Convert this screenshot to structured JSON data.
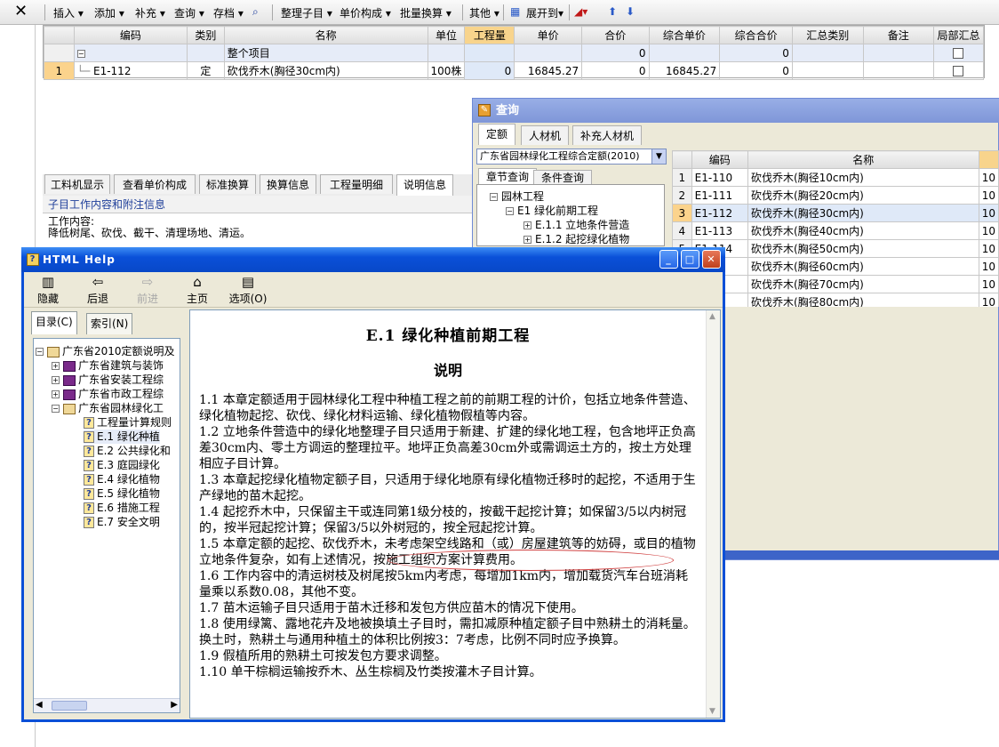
{
  "toolbar": {
    "close": "✕",
    "items": [
      "插入",
      "添加",
      "补充",
      "查询",
      "存档",
      "整理子目",
      "单价构成",
      "批量换算",
      "其他",
      "展开到"
    ]
  },
  "grid": {
    "headers": [
      "编码",
      "类别",
      "名称",
      "单位",
      "工程量",
      "单价",
      "合价",
      "综合单价",
      "综合合价",
      "汇总类别",
      "备注",
      "局部汇总"
    ],
    "summary": {
      "toggle": "−",
      "name": "整个项目",
      "hejia": "0",
      "zonghe_hejia": "0"
    },
    "rows": [
      {
        "num": "1",
        "code": "E1-112",
        "type": "定",
        "name": "砍伐乔木(胸径30cm内)",
        "unit": "100株",
        "qty": "0",
        "price": "16845.27",
        "hejia": "0",
        "zonghe_price": "16845.27",
        "zonghe_hejia": "0"
      }
    ]
  },
  "bottom": {
    "tabs": [
      "工料机显示",
      "查看单价构成",
      "标准换算",
      "换算信息",
      "工程量明细",
      "说明信息"
    ],
    "info_title": "子目工作内容和附注信息",
    "info_line1": "工作内容:",
    "info_line2": "降低树尾、砍伐、截干、清理场地、清运。"
  },
  "query": {
    "title": "查询",
    "tabs": [
      "定额",
      "人材机",
      "补充人材机"
    ],
    "select": "广东省园林绿化工程综合定额(2010)",
    "subtabs": [
      "章节查询",
      "条件查询"
    ],
    "tree": [
      "园林工程",
      "E1 绿化前期工程",
      "E.1.1 立地条件营造",
      "E.1.2 起挖绿化植物"
    ],
    "grid_headers": [
      "编码",
      "名称"
    ],
    "rows": [
      {
        "n": "1",
        "code": "E1-110",
        "name": "砍伐乔木(胸径10cm内)",
        "extra": "10"
      },
      {
        "n": "2",
        "code": "E1-111",
        "name": "砍伐乔木(胸径20cm内)",
        "extra": "10"
      },
      {
        "n": "3",
        "code": "E1-112",
        "name": "砍伐乔木(胸径30cm内)",
        "extra": "10"
      },
      {
        "n": "4",
        "code": "E1-113",
        "name": "砍伐乔木(胸径40cm内)",
        "extra": "10"
      },
      {
        "n": "5",
        "code": "E1-114",
        "name": "砍伐乔木(胸径50cm内)",
        "extra": "10"
      },
      {
        "n": "",
        "code": "",
        "name": "砍伐乔木(胸径60cm内)",
        "extra": "10"
      },
      {
        "n": "",
        "code": "",
        "name": "砍伐乔木(胸径70cm内)",
        "extra": "10"
      },
      {
        "n": "",
        "code": "",
        "name": "砍伐乔木(胸径80cm内)",
        "extra": "10"
      }
    ]
  },
  "help": {
    "title": "HTML Help",
    "tools": [
      "隐藏",
      "后退",
      "前进",
      "主页",
      "选项(O)"
    ],
    "tabs": [
      "目录(C)",
      "索引(N)"
    ],
    "tree": [
      "广东省2010定额说明及",
      "广东省建筑与装饰",
      "广东省安装工程综",
      "广东省市政工程综",
      "广东省园林绿化工",
      "工程量计算规则",
      "E.1 绿化种植",
      "E.2 公共绿化和",
      "E.3 庭园绿化",
      "E.4 绿化植物",
      "E.5 绿化植物",
      "E.6 措施工程",
      "E.7 安全文明"
    ],
    "doc_title": "E.1  绿化种植前期工程",
    "doc_subtitle": "说明",
    "paragraphs": [
      "1.1  本章定额适用于园林绿化工程中种植工程之前的前期工程的计价，包括立地条件营造、绿化植物起挖、砍伐、绿化材料运输、绿化植物假植等内容。",
      "1.2  立地条件营造中的绿化地整理子目只适用于新建、扩建的绿化地工程，包含地坪正负高差30cm内、零土方调运的整理拉平。地坪正负高差30cm外或需调运土方的，按土方处理相应子目计算。",
      "1.3  本章起挖绿化植物定额子目，只适用于绿化地原有绿化植物迁移时的起挖，不适用于生产绿地的苗木起挖。",
      "1.4  起挖乔木中，只保留主干或连同第1级分枝的，按截干起挖计算；如保留3/5以内树冠的，按半冠起挖计算；保留3/5以外树冠的，按全冠起挖计算。",
      "1.5  本章定额的起挖、砍伐乔木，未考虑架空线路和（或）房屋建筑等的妨碍，或目的植物立地条件复杂，如有上述情况，按施工组织方案计算费用。",
      "1.6  工作内容中的清运树枝及树尾按5km内考虑，每增加1km内，增加载货汽车台班消耗量乘以系数0.08，其他不变。",
      "1.7  苗木运输子目只适用于苗木迁移和发包方供应苗木的情况下使用。",
      "1.8  使用绿篱、露地花卉及地被换填土子目时，需扣减原种植定额子目中熟耕土的消耗量。换土时，熟耕土与通用种植土的体积比例按3：7考虑，比例不同时应予换算。",
      "1.9  假植所用的熟耕土可按发包方要求调整。",
      "1.10  单干棕榈运输按乔木、丛生棕榈及竹类按灌木子目计算。"
    ]
  }
}
